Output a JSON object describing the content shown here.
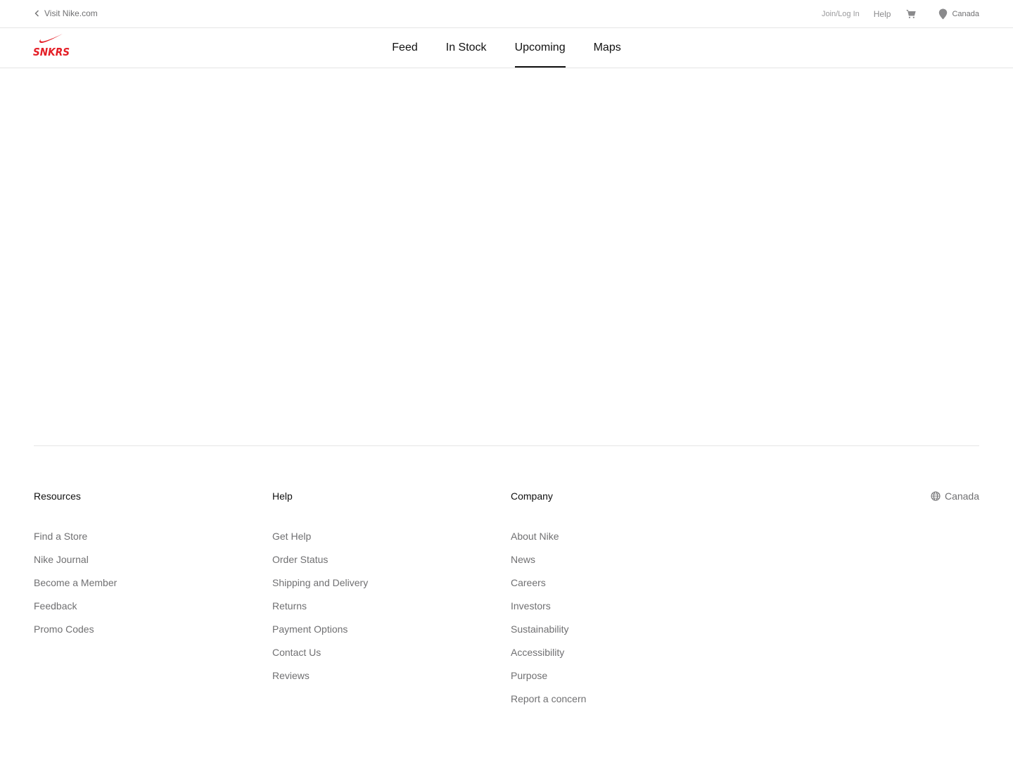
{
  "utility_bar": {
    "visit_label": "Visit Nike.com",
    "join_login": "Join/Log In",
    "help": "Help",
    "location": "Canada"
  },
  "header": {
    "logo_text": "SNKRS",
    "tabs": [
      {
        "label": "Feed",
        "active": false
      },
      {
        "label": "In Stock",
        "active": false
      },
      {
        "label": "Upcoming",
        "active": true
      },
      {
        "label": "Maps",
        "active": false
      }
    ]
  },
  "footer": {
    "resources": {
      "title": "Resources",
      "links": [
        "Find a Store",
        "Nike Journal",
        "Become a Member",
        "Feedback",
        "Promo Codes"
      ]
    },
    "help": {
      "title": "Help",
      "links": [
        "Get Help",
        "Order Status",
        "Shipping and Delivery",
        "Returns",
        "Payment Options",
        "Contact Us",
        "Reviews"
      ]
    },
    "company": {
      "title": "Company",
      "links": [
        "About Nike",
        "News",
        "Careers",
        "Investors",
        "Sustainability",
        "Accessibility",
        "Purpose",
        "Report a concern"
      ]
    },
    "locale": "Canada"
  },
  "colors": {
    "brand_red": "#e41e26",
    "text_primary": "#111111",
    "text_secondary": "#707072",
    "divider": "#e5e5e5"
  }
}
